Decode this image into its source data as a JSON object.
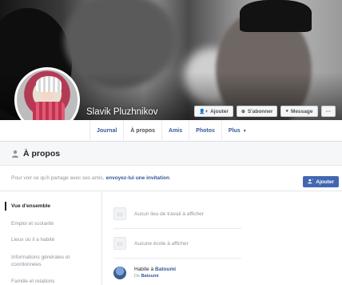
{
  "profile": {
    "name": "Slavik Pluzhnikov"
  },
  "cover_actions": [
    {
      "icon": "add-friend-icon",
      "glyph": "👤+",
      "label": "Ajouter"
    },
    {
      "icon": "rss-icon",
      "glyph": "⊕",
      "label": "S'abonner"
    },
    {
      "icon": "messenger-icon",
      "glyph": "●",
      "label": "Message"
    },
    {
      "icon": "more-icon",
      "glyph": "",
      "label": "···"
    }
  ],
  "tabs": [
    {
      "label": "Journal"
    },
    {
      "label": "À propos"
    },
    {
      "label": "Amis"
    },
    {
      "label": "Photos"
    },
    {
      "label": "Plus",
      "caret": "▼"
    }
  ],
  "section": {
    "icon": "person-icon",
    "title": "À propos"
  },
  "notice": {
    "text": "Pour voir ce qu'il partage avec ses amis,",
    "link": "envoyez-lui une invitation",
    "suffix": "."
  },
  "add_button": {
    "icon": "add-friend-icon",
    "label": "Ajouter"
  },
  "sidebar": {
    "items": [
      {
        "label": "Vue d'ensemble"
      },
      {
        "label": "Emploi et scolarité"
      },
      {
        "label": "Lieux où il a habité"
      },
      {
        "label": "Informations générales et coordonnées"
      },
      {
        "label": "Famille et relations"
      }
    ]
  },
  "overview": {
    "work": "Aucun lieu de travail à afficher",
    "school": "Aucune école à afficher",
    "lives_prefix": "Habite à",
    "lives_city": "Batoumi",
    "from_prefix": "De",
    "from_city": "Batoumi"
  },
  "colors": {
    "link": "#365899",
    "primary_button": "#4267b2",
    "muted_text": "#90949c"
  }
}
